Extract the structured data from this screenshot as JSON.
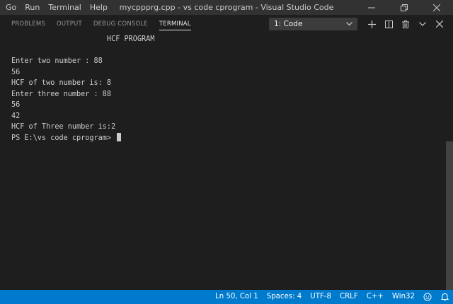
{
  "menu": [
    "Go",
    "Run",
    "Terminal",
    "Help"
  ],
  "window_title": "mycppprg.cpp - vs code cprogram - Visual Studio Code",
  "panel": {
    "tabs": [
      {
        "label": "PROBLEMS",
        "active": false
      },
      {
        "label": "OUTPUT",
        "active": false
      },
      {
        "label": "DEBUG CONSOLE",
        "active": false
      },
      {
        "label": "TERMINAL",
        "active": true
      }
    ],
    "terminal_select": "1: Code",
    "actions": [
      "plus-icon",
      "split-icon",
      "trash-icon",
      "chevron-down-icon",
      "close-icon"
    ]
  },
  "terminal_lines": [
    "                      HCF PROGRAM",
    "",
    "Enter two number : 88",
    "56",
    "HCF of two number is: 8",
    "Enter three number : 88",
    "56",
    "42",
    "HCF of Three number is:2",
    "PS E:\\vs code cprogram> "
  ],
  "status": {
    "position": "Ln 50, Col 1",
    "spaces": "Spaces: 4",
    "encoding": "UTF-8",
    "eol": "CRLF",
    "language": "C++",
    "platform": "Win32"
  },
  "colors": {
    "titlebar": "#323233",
    "editor_bg": "#1e1e1e",
    "statusbar": "#007acc",
    "text": "#cccccc"
  }
}
